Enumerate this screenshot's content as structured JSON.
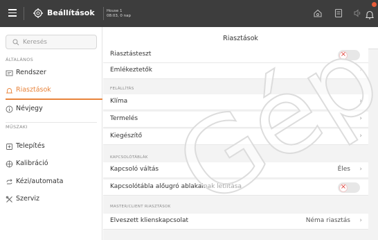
{
  "topbar": {
    "title": "Beállítások",
    "house_name": "House 1",
    "house_status": "08:03, 0 nap"
  },
  "sidebar": {
    "search_placeholder": "Keresés",
    "sections": {
      "general": "ÁLTALÁNOS",
      "technical": "MŰSZAKI"
    },
    "items": [
      {
        "label": "Rendszer"
      },
      {
        "label": "Riasztások"
      },
      {
        "label": "Névjegy"
      },
      {
        "label": "Telepítés"
      },
      {
        "label": "Kalibráció"
      },
      {
        "label": "Kézi/automata"
      },
      {
        "label": "Szerviz"
      }
    ],
    "active": "Riasztások"
  },
  "main": {
    "title": "Riasztások",
    "rows_top": [
      {
        "label": "Riasztásteszt"
      },
      {
        "label": "Emlékeztetők"
      }
    ],
    "group_felallitas": "FELÁLLÍTÁS",
    "rows_felallitas": [
      {
        "label": "Klíma"
      },
      {
        "label": "Termelés"
      },
      {
        "label": "Kiegészítő"
      }
    ],
    "group_kapcsolo": "KAPCSOLÓTÁBLÁK",
    "rows_kapcsolo": [
      {
        "label": "Kapcsoló váltás",
        "value": "Éles"
      },
      {
        "label": "Kapcsolótábla alőugró ablakainak letiltása"
      }
    ],
    "group_master": "MASTER/CLIENT RIASZTÁSOK",
    "rows_master": [
      {
        "label": "Elveszett klienskapcsolat",
        "value": "Néma riasztás"
      }
    ]
  },
  "watermark": "Gép",
  "colors": {
    "topbar_bg": "#3d3d3d",
    "accent": "#e8833a",
    "toggle_off_mark": "#e0403a",
    "badge": "#e85d3a"
  },
  "icons": [
    "menu-icon",
    "gear-icon",
    "home-icon",
    "document-icon",
    "sound-icon",
    "bell-icon",
    "search-icon",
    "system-icon",
    "alarm-icon",
    "info-icon",
    "install-icon",
    "calibration-icon",
    "manual-auto-icon",
    "service-icon",
    "chevron-right-icon"
  ]
}
